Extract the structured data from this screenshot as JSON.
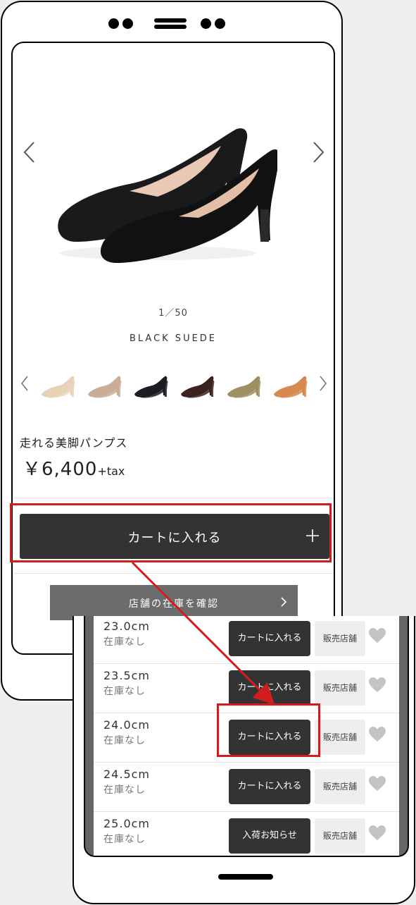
{
  "gallery": {
    "counter": "1／50",
    "color_name": "BLACK SUEDE",
    "prev_glyph": "〈",
    "next_glyph": "〉"
  },
  "swatches": [
    {
      "name": "beige",
      "color": "#e7d2b8"
    },
    {
      "name": "greige",
      "color": "#c9ad98"
    },
    {
      "name": "black",
      "color": "#1c1c22"
    },
    {
      "name": "dark-brown",
      "color": "#3b2220"
    },
    {
      "name": "khaki",
      "color": "#9c8f62"
    },
    {
      "name": "camel",
      "color": "#d6884f"
    }
  ],
  "product": {
    "name": "走れる美脚パンプス",
    "price": "￥6,400",
    "tax": "+tax"
  },
  "actions": {
    "add_to_cart": "カートに入れる",
    "add_plus": "＋",
    "check_store_stock": "店舗の在庫を確認",
    "check_store_chevron": "〉"
  },
  "size_list": [
    {
      "size": "23.0cm",
      "stock": "在庫なし",
      "action": "カートに入れる",
      "shop": "販売店舗"
    },
    {
      "size": "23.5cm",
      "stock": "在庫なし",
      "action": "カートに入れる",
      "shop": "販売店舗"
    },
    {
      "size": "24.0cm",
      "stock": "在庫なし",
      "action": "カートに入れる",
      "shop": "販売店舗"
    },
    {
      "size": "24.5cm",
      "stock": "在庫なし",
      "action": "カートに入れる",
      "shop": "販売店舗"
    },
    {
      "size": "25.0cm",
      "stock": "在庫なし",
      "action": "入荷お知らせ",
      "shop": "販売店舗"
    }
  ],
  "colors": {
    "button_dark": "#333333",
    "button_gray": "#6c6c6c",
    "highlight": "#d31d1d"
  }
}
